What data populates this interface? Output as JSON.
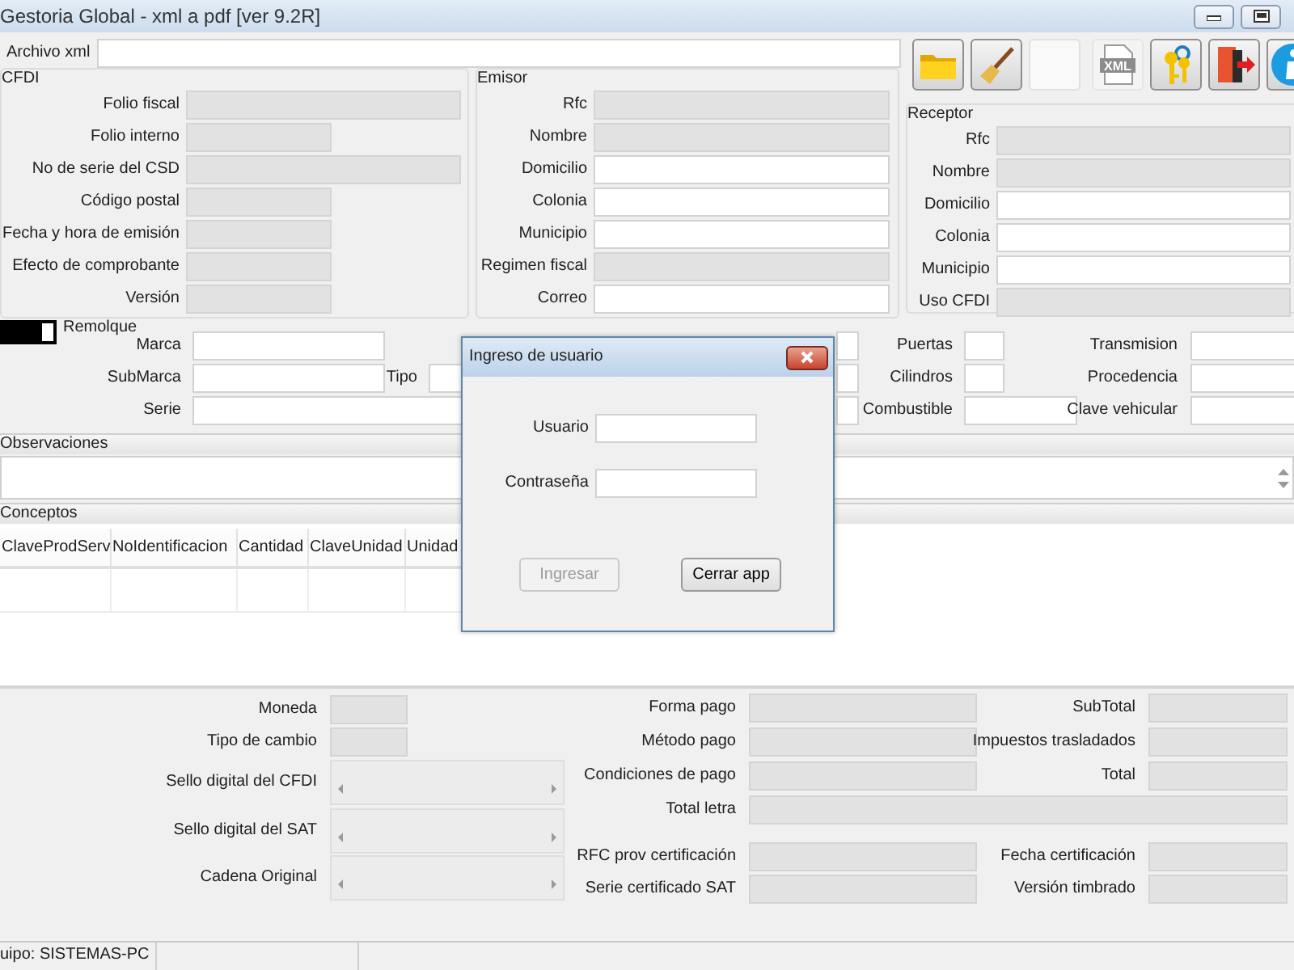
{
  "window": {
    "title": "Gestoria Global - xml a pdf [ver 9.2R]"
  },
  "archivo_xml": {
    "label": "Archivo xml"
  },
  "toolbar": [
    {
      "kind": "open"
    },
    {
      "kind": "clean"
    },
    {
      "kind": "blank"
    },
    {
      "kind": "xml",
      "label": "XML"
    },
    {
      "kind": "keys"
    },
    {
      "kind": "exit"
    },
    {
      "kind": "info"
    }
  ],
  "cfdi": {
    "title": "CFDI",
    "fields": [
      {
        "label": "Folio fiscal",
        "disabled": true
      },
      {
        "label": "Folio interno",
        "disabled": true
      },
      {
        "label": "No de serie del CSD",
        "disabled": true
      },
      {
        "label": "Código postal",
        "disabled": true
      },
      {
        "label": "Fecha y hora de emisión",
        "disabled": true
      },
      {
        "label": "Efecto de comprobante",
        "disabled": true
      },
      {
        "label": "Versión",
        "disabled": true
      }
    ]
  },
  "emisor": {
    "title": "Emisor",
    "fields": [
      {
        "label": "Rfc",
        "disabled": true
      },
      {
        "label": "Nombre",
        "disabled": true
      },
      {
        "label": "Domicilio",
        "disabled": false
      },
      {
        "label": "Colonia",
        "disabled": false
      },
      {
        "label": "Municipio",
        "disabled": false
      },
      {
        "label": "Regimen fiscal",
        "disabled": true
      },
      {
        "label": "Correo",
        "disabled": false
      }
    ]
  },
  "receptor": {
    "title": "Receptor",
    "fields": [
      {
        "label": "Rfc",
        "disabled": true
      },
      {
        "label": "Nombre",
        "disabled": true
      },
      {
        "label": "Domicilio",
        "disabled": false
      },
      {
        "label": "Colonia",
        "disabled": false
      },
      {
        "label": "Municipio",
        "disabled": false
      },
      {
        "label": "Uso CFDI",
        "disabled": true
      }
    ]
  },
  "vehiculo": {
    "remolque": {
      "label": "Remolque",
      "checked": true
    },
    "fields": [
      {
        "label": "Marca"
      },
      {
        "label": "Puertas"
      },
      {
        "label": "Transmision"
      },
      {
        "label": "SubMarca"
      },
      {
        "label": "Tipo"
      },
      {
        "label": "Cilindros"
      },
      {
        "label": "Procedencia"
      },
      {
        "label": "Serie"
      },
      {
        "label": "Combustible"
      },
      {
        "label": "Clave vehicular"
      }
    ]
  },
  "observaciones": {
    "title": "Observaciones"
  },
  "conceptos": {
    "title": "Conceptos",
    "columns": [
      "ClaveProdServ",
      "NoIdentificacion",
      "Cantidad",
      "ClaveUnidad",
      "Unidad"
    ]
  },
  "comprobante": [
    {
      "label": "Moneda",
      "kind": "field"
    },
    {
      "label": "Tipo de cambio",
      "kind": "field"
    },
    {
      "label": "Sello digital del CFDI",
      "kind": "scroll"
    },
    {
      "label": "Sello digital del SAT",
      "kind": "scroll"
    },
    {
      "label": "Cadena Original",
      "kind": "scroll"
    }
  ],
  "pago": [
    {
      "label": "Forma pago"
    },
    {
      "label": "Método pago"
    },
    {
      "label": "Condiciones de pago"
    },
    {
      "label": "Total letra"
    },
    {
      "label": "RFC prov certificación"
    },
    {
      "label": "Serie certificado SAT"
    }
  ],
  "importes": [
    {
      "label": "SubTotal"
    },
    {
      "label": "Impuestos trasladados"
    },
    {
      "label": "Total"
    },
    {
      "label": "Fecha certificación"
    },
    {
      "label": "Versión timbrado"
    }
  ],
  "status_bar": {
    "text": "uipo: SISTEMAS-PC"
  },
  "dialog": {
    "title": "Ingreso de usuario",
    "fields": [
      {
        "label": "Usuario"
      },
      {
        "label": "Contraseña"
      }
    ],
    "buttons": [
      {
        "label": "Ingresar",
        "disabled": true
      },
      {
        "label": "Cerrar app",
        "disabled": false
      }
    ]
  }
}
